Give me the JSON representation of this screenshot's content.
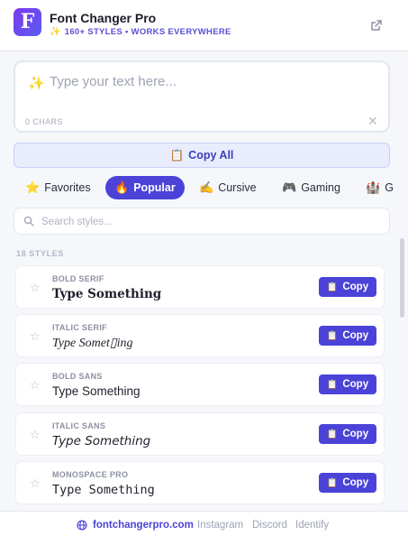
{
  "header": {
    "logo_letter": "F",
    "title": "Font Changer Pro",
    "subtitle_icon": "sparkle-icon",
    "subtitle": "160+ STYLES • WORKS EVERYWHERE",
    "open_external_icon": "external-link-icon"
  },
  "input": {
    "placeholder": "Type your text here...",
    "char_count": "0 CHARS",
    "clear_symbol": "✕"
  },
  "copy_all": {
    "label": "Copy All"
  },
  "tabs": [
    {
      "icon": "⭐",
      "label": "Favorites"
    },
    {
      "icon": "🔥",
      "label": "Popular"
    },
    {
      "icon": "✍️",
      "label": "Cursive"
    },
    {
      "icon": "🎮",
      "label": "Gaming"
    },
    {
      "icon": "🏰",
      "label": "G"
    }
  ],
  "search": {
    "placeholder": "Search styles..."
  },
  "styles_count": "18 STYLES",
  "styles": [
    {
      "name": "BOLD SERIF",
      "preview": "Type Something",
      "copy_label": "Copy"
    },
    {
      "name": "ITALIC SERIF",
      "preview": "Type Somet▯ing",
      "copy_label": "Copy"
    },
    {
      "name": "BOLD SANS",
      "preview": "Type Something",
      "copy_label": "Copy"
    },
    {
      "name": "ITALIC SANS",
      "preview": "Type Something",
      "copy_label": "Copy"
    },
    {
      "name": "MONOSPACE PRO",
      "preview": "Type Something",
      "copy_label": "Copy"
    }
  ],
  "footer": {
    "site": "fontchangerpro.com",
    "links": [
      "Instagram",
      "Discord",
      "Identify"
    ]
  },
  "colors": {
    "accent": "#4b43d8",
    "brand_gradient_start": "#7c3aed",
    "background": "#f6f7fb"
  }
}
